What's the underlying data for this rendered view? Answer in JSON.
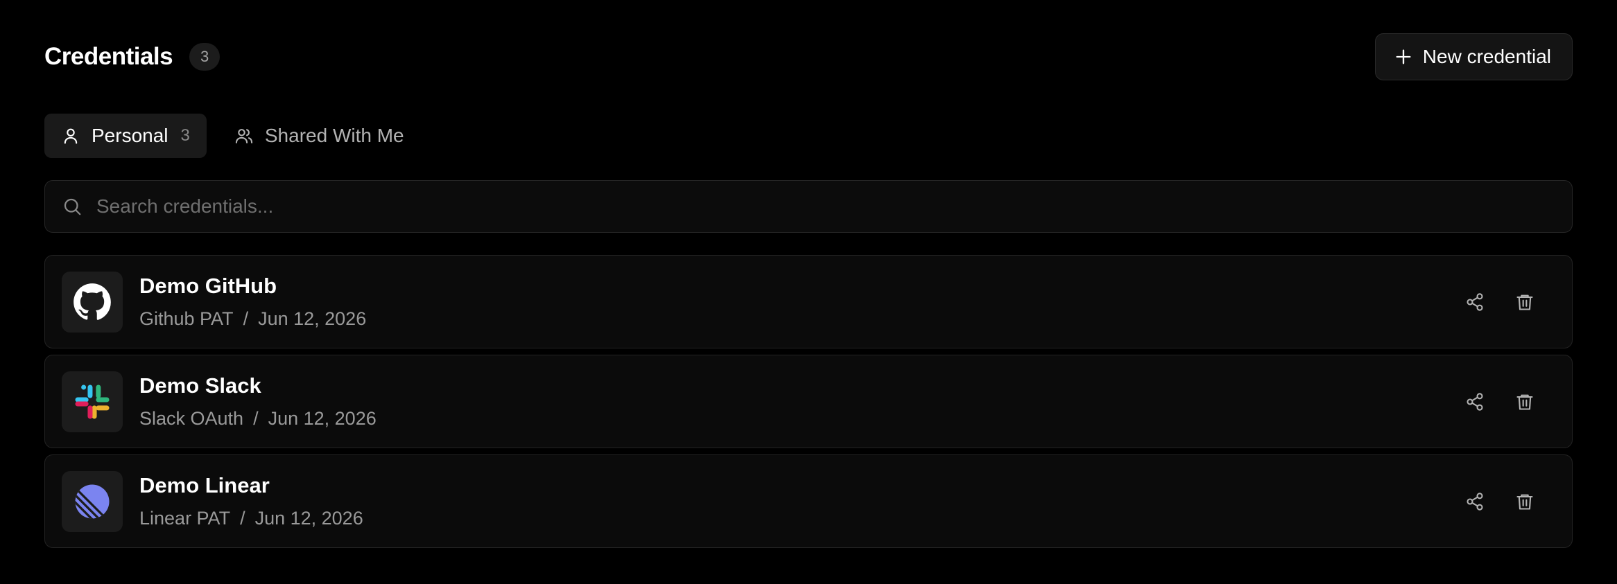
{
  "header": {
    "title": "Credentials",
    "count": "3",
    "new_button_label": "New credential"
  },
  "tabs": [
    {
      "label": "Personal",
      "count": "3",
      "icon": "user-icon",
      "active": true
    },
    {
      "label": "Shared With Me",
      "icon": "users-icon",
      "active": false
    }
  ],
  "search": {
    "placeholder": "Search credentials...",
    "value": ""
  },
  "credentials": [
    {
      "name": "Demo GitHub",
      "type": "Github PAT",
      "separator": "/",
      "date": "Jun 12, 2026",
      "icon": "github-logo-icon"
    },
    {
      "name": "Demo Slack",
      "type": "Slack OAuth",
      "separator": "/",
      "date": "Jun 12, 2026",
      "icon": "slack-logo-icon"
    },
    {
      "name": "Demo Linear",
      "type": "Linear PAT",
      "separator": "/",
      "date": "Jun 12, 2026",
      "icon": "linear-logo-icon"
    }
  ],
  "colors": {
    "background": "#000000",
    "surface": "#0b0b0b",
    "border": "#232323",
    "muted_text": "#9a9a9a",
    "linear_brand": "#7B84F0"
  }
}
